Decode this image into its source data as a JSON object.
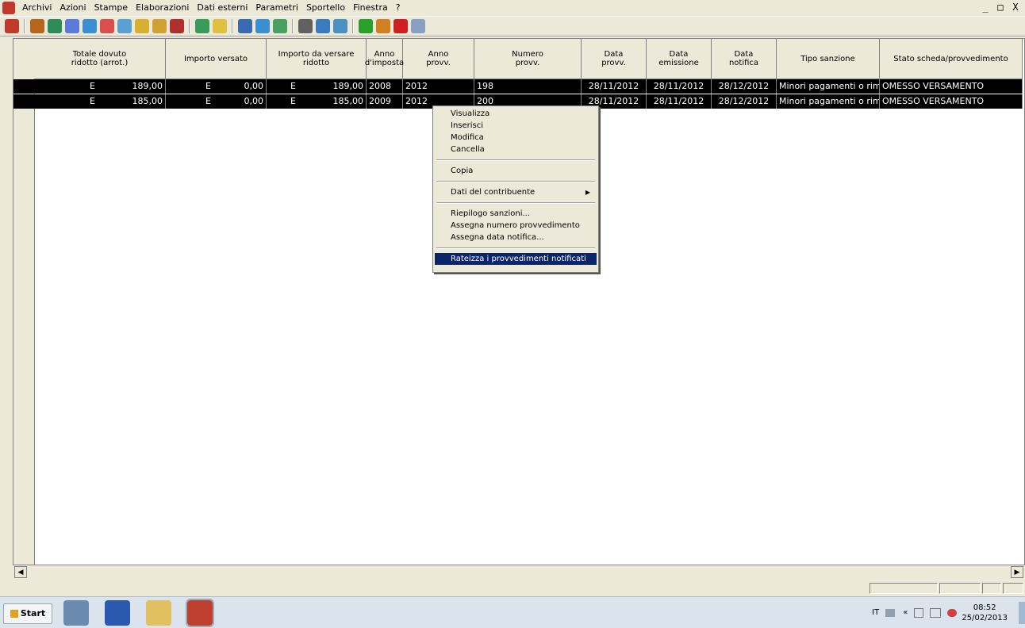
{
  "menubar": {
    "items": [
      "Archivi",
      "Azioni",
      "Stampe",
      "Elaborazioni",
      "Dati esterni",
      "Parametri",
      "Sportello",
      "Finestra",
      "?"
    ],
    "window_controls": [
      "_",
      "&#8801;",
      "X"
    ]
  },
  "toolbar": {
    "buttons": [
      {
        "icon": "back-icon",
        "color": "#c0392b"
      },
      {
        "icon": "people-icon",
        "color": "#b5651d"
      },
      {
        "icon": "house-icon",
        "color": "#2e8b57"
      },
      {
        "icon": "gear-icon",
        "color": "#5a7bd8"
      },
      {
        "icon": "edit-icon",
        "color": "#3a8fd0"
      },
      {
        "icon": "check-icon",
        "color": "#d94f4f"
      },
      {
        "icon": "table-icon",
        "color": "#5aa0d0"
      },
      {
        "icon": "calendar-icon",
        "color": "#d8b030"
      },
      {
        "icon": "card-icon",
        "color": "#d0a030"
      },
      {
        "icon": "book-icon",
        "color": "#b03030"
      },
      {
        "icon": "globe-icon",
        "color": "#3a9a5a"
      },
      {
        "icon": "folder-icon",
        "color": "#e0c040"
      },
      {
        "icon": "user-icon",
        "color": "#3a6ab0"
      },
      {
        "icon": "refresh-icon",
        "color": "#3a8fd0"
      },
      {
        "icon": "world-icon",
        "color": "#4aa060"
      },
      {
        "icon": "binoculars-icon",
        "color": "#606060"
      },
      {
        "icon": "filter-icon",
        "color": "#3a7ac0"
      },
      {
        "icon": "search-icon",
        "color": "#4a90c0"
      },
      {
        "icon": "add-icon",
        "color": "#2aa02a"
      },
      {
        "icon": "pencil-icon",
        "color": "#d08020"
      },
      {
        "icon": "delete-icon",
        "color": "#d02020"
      },
      {
        "icon": "copy-icon",
        "color": "#8aa0c0"
      }
    ]
  },
  "grid": {
    "columns": [
      {
        "label": "Totale dovuto\nridotto (arrot.)",
        "w": 166
      },
      {
        "label": "Importo versato",
        "w": 127
      },
      {
        "label": "Importo da versare\nridotto",
        "w": 126
      },
      {
        "label": "Anno\nd'imposta",
        "w": 46
      },
      {
        "label": "Anno\nprovv.",
        "w": 90
      },
      {
        "label": "Numero\nprovv.",
        "w": 135
      },
      {
        "label": "Data\nprovv.",
        "w": 82
      },
      {
        "label": "Data\nemissione",
        "w": 82
      },
      {
        "label": "Data\nnotifica",
        "w": 82
      },
      {
        "label": "Tipo sanzione",
        "w": 130
      },
      {
        "label": "Stato scheda/provvedimento",
        "w": 180
      }
    ],
    "rows": [
      {
        "c1": "E",
        "v1": "189,00",
        "c2": "E",
        "v2": "0,00",
        "c3": "E",
        "v3": "189,00",
        "anno_imposta": "2008",
        "anno_provv": "2012",
        "numero": "198",
        "data_provv": "28/11/2012",
        "data_emissione": "28/11/2012",
        "data_notifica": "28/12/2012",
        "tipo": "Minori pagamenti o rimbor",
        "stato": "OMESSO VERSAMENTO"
      },
      {
        "c1": "E",
        "v1": "185,00",
        "c2": "E",
        "v2": "0,00",
        "c3": "E",
        "v3": "185,00",
        "anno_imposta": "2009",
        "anno_provv": "2012",
        "numero": "200",
        "data_provv": "28/11/2012",
        "data_emissione": "28/11/2012",
        "data_notifica": "28/12/2012",
        "tipo": "Minori pagamenti o rimbor",
        "stato": "OMESSO VERSAMENTO"
      }
    ]
  },
  "context_menu": {
    "items": [
      {
        "label": "Visualizza"
      },
      {
        "label": "Inserisci"
      },
      {
        "label": "Modifica"
      },
      {
        "label": "Cancella"
      },
      {
        "sep": true
      },
      {
        "label": "Copia"
      },
      {
        "sep": true
      },
      {
        "label": "Dati del contribuente",
        "submenu": true
      },
      {
        "sep": true
      },
      {
        "label": "Riepilogo sanzioni..."
      },
      {
        "label": "Assegna numero provvedimento"
      },
      {
        "label": "Assegna data notifica..."
      },
      {
        "sep": true
      },
      {
        "label": "Rateizza i provvedimenti notificati",
        "selected": true
      }
    ]
  },
  "taskbar": {
    "start_label": "Start",
    "apps": [
      {
        "icon": "server-icon",
        "color": "#6a8ab0"
      },
      {
        "icon": "powershell-icon",
        "color": "#2a5ab0"
      },
      {
        "icon": "explorer-folder-icon",
        "color": "#e0c060"
      },
      {
        "icon": "app-house-icon",
        "color": "#c04030"
      }
    ],
    "tray": {
      "lang": "IT",
      "time": "08:52",
      "date": "25/02/2013"
    }
  }
}
